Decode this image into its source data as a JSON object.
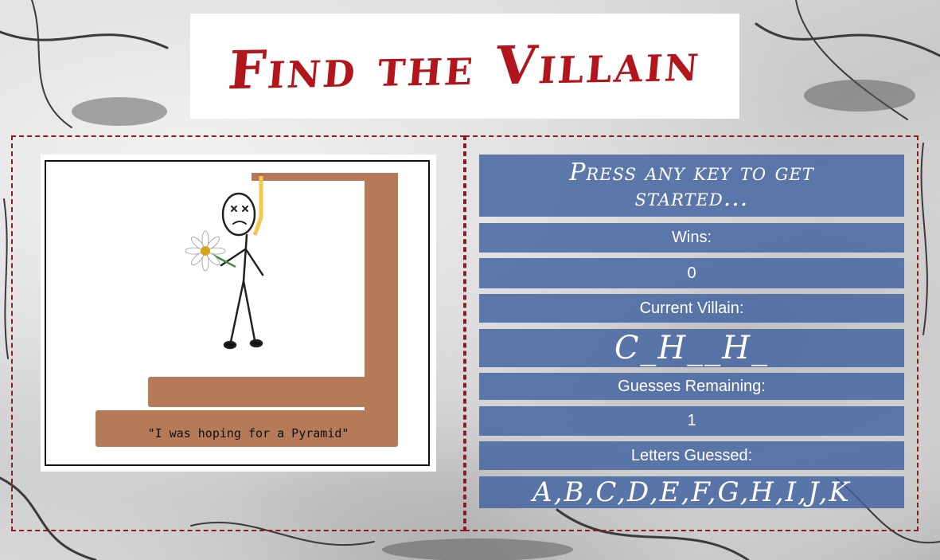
{
  "app": {
    "title": "Find the Villain"
  },
  "colors": {
    "title_red": "#b3151c",
    "panel_border": "#8c1d1d",
    "row_blue": "#3f62a0",
    "gallows_brown": "#b57a58",
    "rope_yellow": "#f2c94c"
  },
  "image": {
    "caption": "\"I was hoping for a Pyramid\""
  },
  "status": {
    "prompt": "Press any key to get started...",
    "wins_label": "Wins:",
    "wins_value": "0",
    "villain_label": "Current Villain:",
    "villain_value": "C_H__H_",
    "guesses_label": "Guesses Remaining:",
    "guesses_value": "1",
    "letters_label": "Letters Guessed:",
    "letters_value": "A,B,C,D,E,F,G,H,I,J,K"
  },
  "icons": {
    "hanged_figure": "stick-figure-icon",
    "flower": "daisy-icon",
    "gallows": "gallows-icon",
    "rope": "noose-icon"
  }
}
